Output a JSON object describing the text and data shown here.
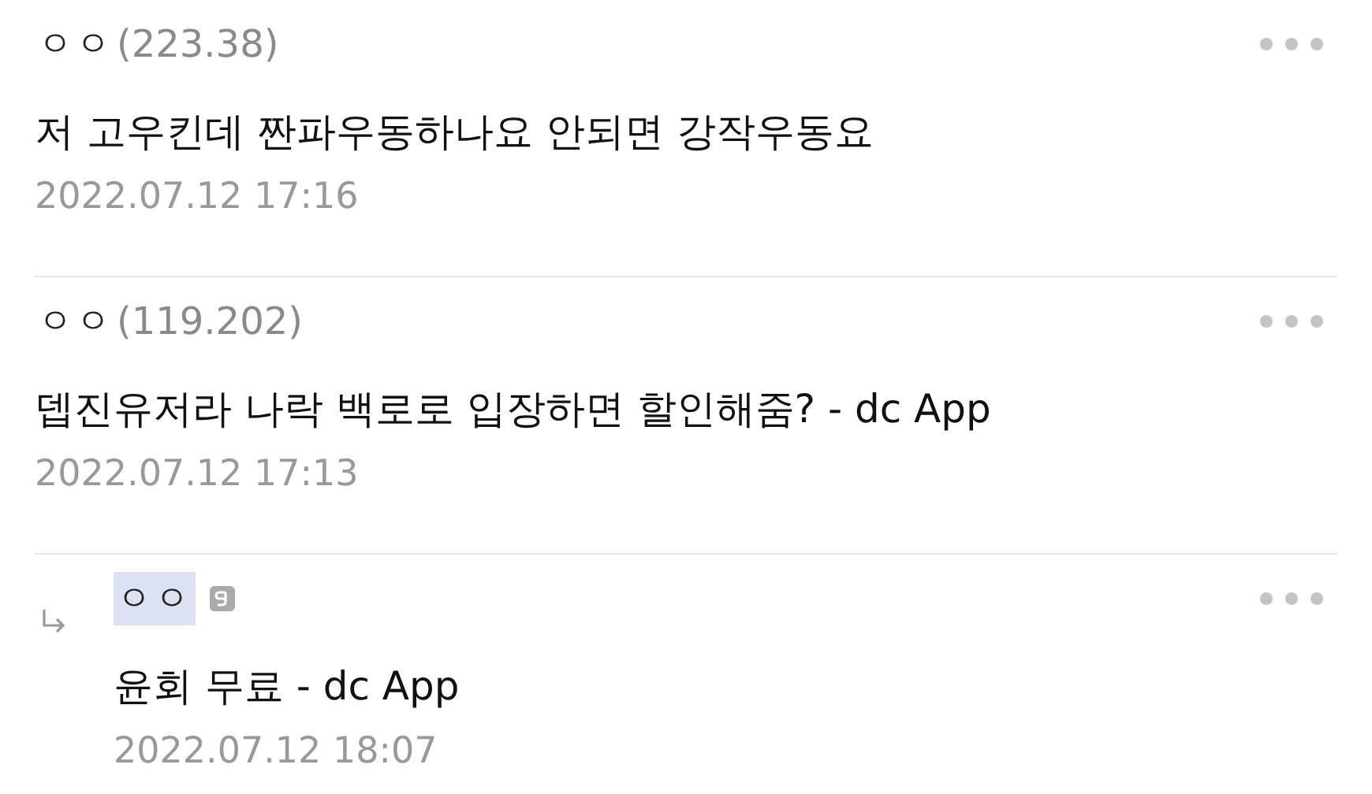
{
  "comments": [
    {
      "kind": "comment",
      "author": "ㅇㅇ",
      "ip": "(223.38)",
      "author_highlighted": false,
      "member_icon": false,
      "text": "저 고우킨데 짠파우동하나요 안되면 강작우동요",
      "time": "2022.07.12 17:16"
    },
    {
      "kind": "comment",
      "author": "ㅇㅇ",
      "ip": "(119.202)",
      "author_highlighted": false,
      "member_icon": false,
      "text": "뎁진유저라 나락 백로로 입장하면 할인해줌? - dc App",
      "time": "2022.07.12 17:13"
    },
    {
      "kind": "reply",
      "author": "ㅇㅇ",
      "author_highlighted": true,
      "member_icon": true,
      "text": "윤회 무료 - dc App",
      "time": "2022.07.12 18:07"
    }
  ]
}
